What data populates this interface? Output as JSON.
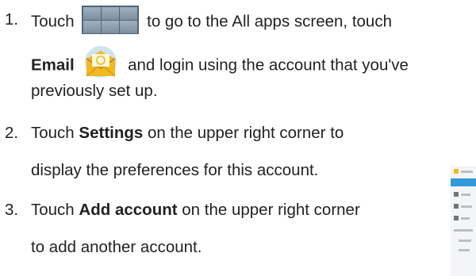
{
  "steps": [
    {
      "number": "1.",
      "line1_a": "Touch",
      "line1_b": "to go to the All apps screen, touch",
      "line2_bold": "Email",
      "line2_b": "and login using the account that you've",
      "line3": "previously set up.",
      "icons": [
        "apps-grid-icon",
        "email-app-icon"
      ]
    },
    {
      "number": "2.",
      "line1_a": "Touch",
      "line1_bold": "Settings",
      "line1_b": "on the upper right corner to",
      "line2": "display the preferences for this account."
    },
    {
      "number": "3.",
      "line1_a": "Touch",
      "line1_bold": "Add account",
      "line1_b": "on the upper right corner",
      "line2": "to add another account."
    }
  ],
  "colors": {
    "text": "#231f20",
    "apps_icon": "#4f6579",
    "email_icon": "#f2b824",
    "highlight": "#2f9ad8"
  }
}
